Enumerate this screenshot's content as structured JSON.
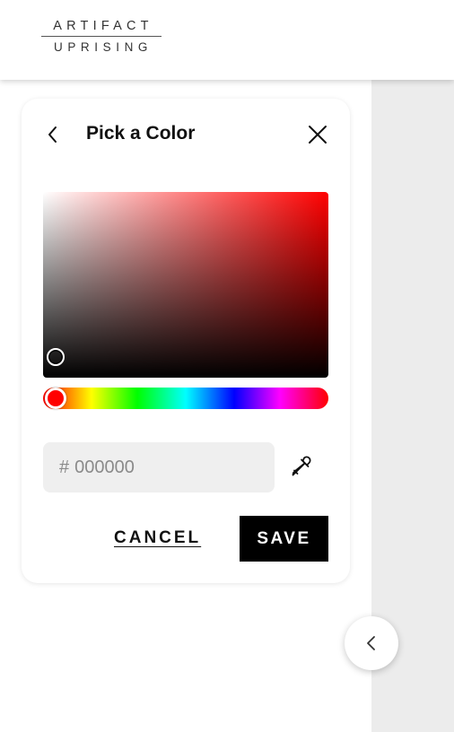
{
  "brand": {
    "line1": "ARTIFACT",
    "line2": "UPRISING"
  },
  "dialog": {
    "title": "Pick a Color",
    "hex_prefix": "#",
    "hex_placeholder": "000000",
    "hex_value": "",
    "cancel_label": "CANCEL",
    "save_label": "SAVE",
    "selected_hue_color": "#ff0000",
    "saturation": 0.0,
    "brightness": 0.05,
    "hue": 0
  },
  "icons": {
    "back": "chevron-left-icon",
    "close": "close-icon",
    "eyedropper": "eyedropper-icon",
    "collapse": "chevron-left-icon"
  },
  "colors": {
    "panel_gray": "#ececec",
    "save_bg": "#000000"
  }
}
